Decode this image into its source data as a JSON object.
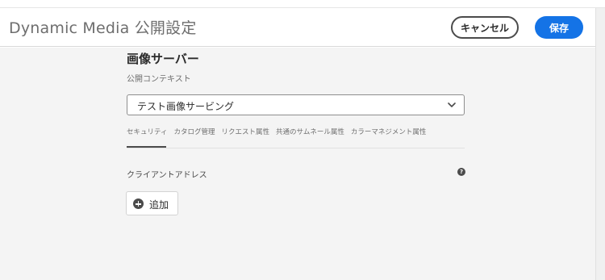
{
  "header": {
    "title": "Dynamic Media 公開設定",
    "cancel_label": "キャンセル",
    "save_label": "保存"
  },
  "page": {
    "title": "画像サーバー",
    "context_label": "公開コンテキスト",
    "context_value": "テスト画像サービング"
  },
  "tabs": [
    {
      "label": "セキュリティ",
      "active": true
    },
    {
      "label": "カタログ管理",
      "active": false
    },
    {
      "label": "リクエスト属性",
      "active": false
    },
    {
      "label": "共通のサムネール属性",
      "active": false
    },
    {
      "label": "カラーマネジメント属性",
      "active": false
    }
  ],
  "security": {
    "client_address_label": "クライアントアドレス",
    "help_icon": "?",
    "add_label": "追加"
  },
  "icons": {
    "dropdown": "chevron-down-icon",
    "help": "help-icon",
    "add": "add-circle-icon"
  },
  "colors": {
    "accent": "#1473e6",
    "background": "#f4f4f4"
  }
}
